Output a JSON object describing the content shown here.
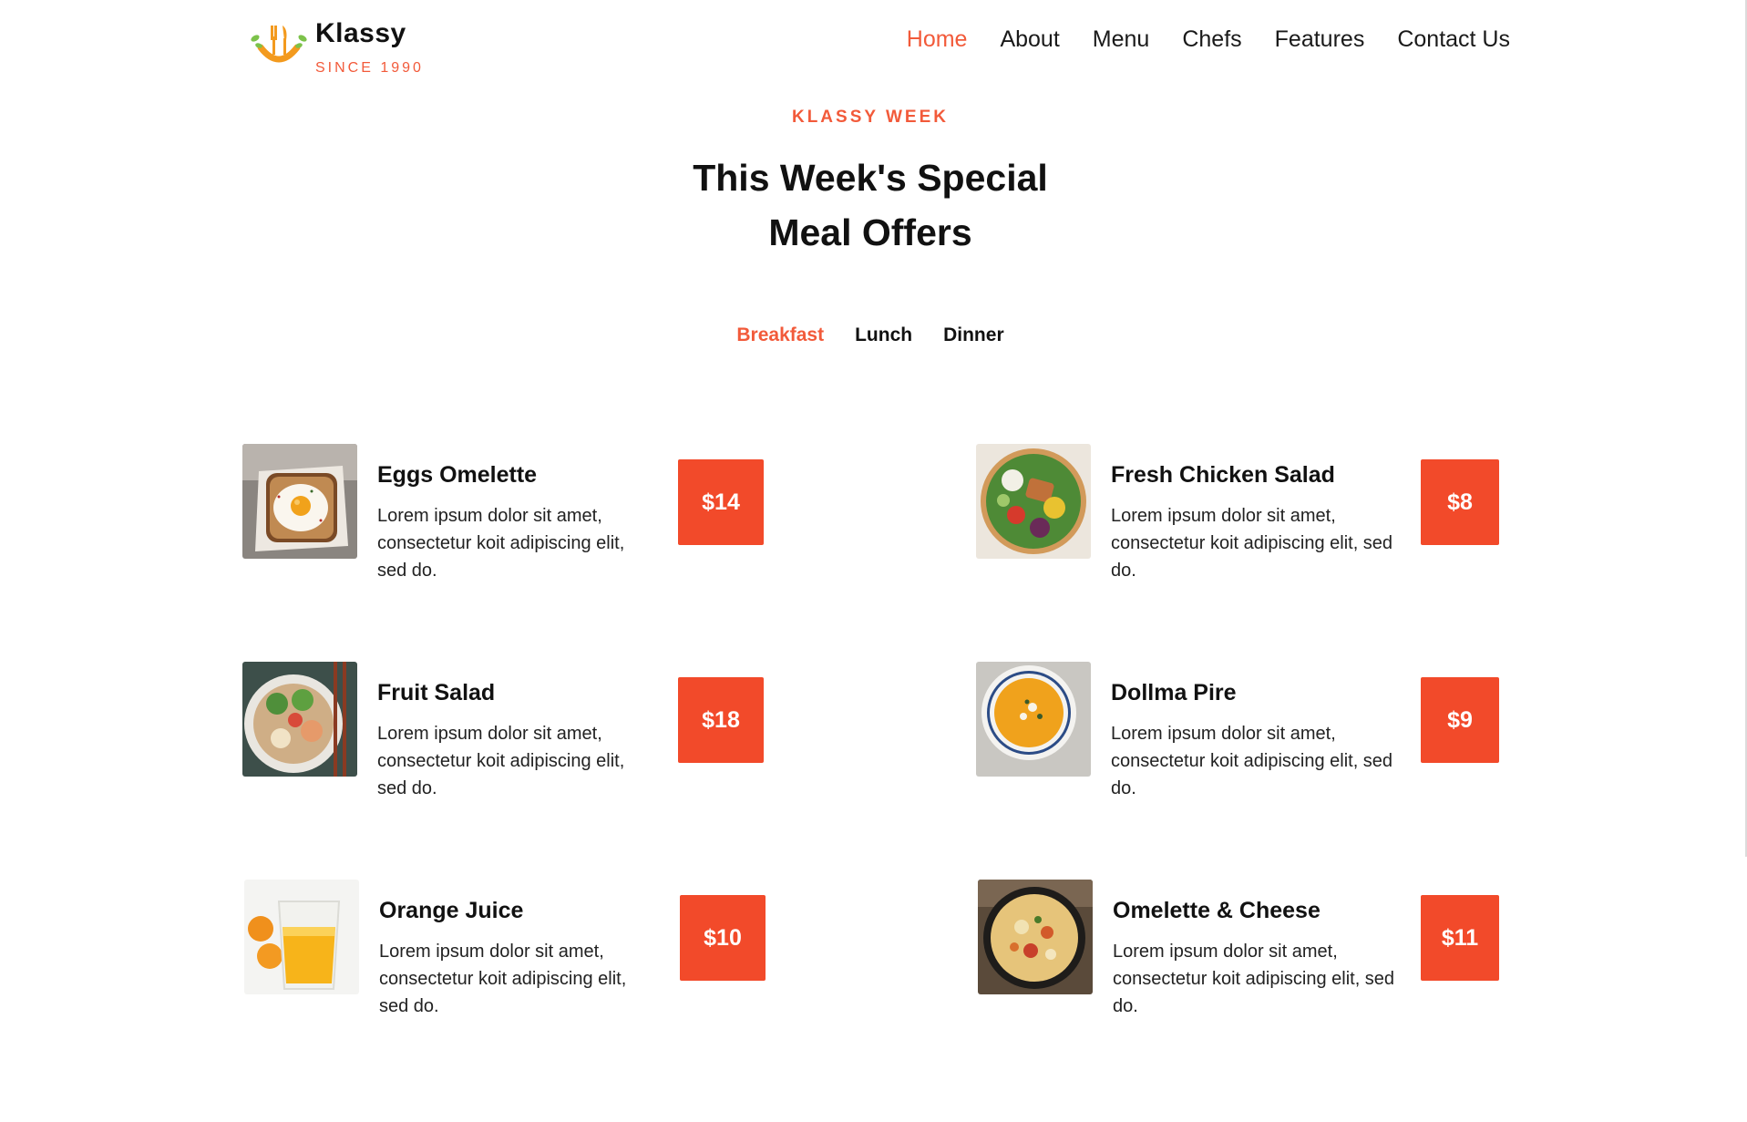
{
  "brand": {
    "name": "Klassy",
    "tagline": "SINCE 1990",
    "accent_color": "#f25a3a",
    "logo_icon": "fork-knife-smile-logo"
  },
  "nav": {
    "items": [
      "Home",
      "About",
      "Menu",
      "Chefs",
      "Features",
      "Contact Us"
    ],
    "active": "Home"
  },
  "section": {
    "eyebrow": "KLASSY WEEK",
    "title_line1": "This Week's Special",
    "title_line2": "Meal Offers"
  },
  "tabs": {
    "items": [
      "Breakfast",
      "Lunch",
      "Dinner"
    ],
    "active": "Breakfast"
  },
  "menu": [
    {
      "name": "Eggs Omelette",
      "desc": "Lorem ipsum dolor sit amet, consectetur koit adipiscing elit, sed do.",
      "price": "$14",
      "image": "fried-egg-toast-photo"
    },
    {
      "name": "Fresh Chicken Salad",
      "desc": "Lorem ipsum dolor sit amet, consectetur koit adipiscing elit, sed do.",
      "price": "$8",
      "image": "chicken-salad-bowl-photo"
    },
    {
      "name": "Fruit Salad",
      "desc": "Lorem ipsum dolor sit amet, consectetur koit adipiscing elit, sed do.",
      "price": "$18",
      "image": "fruit-salad-bowl-photo"
    },
    {
      "name": "Dollma Pire",
      "desc": "Lorem ipsum dolor sit amet, consectetur koit adipiscing elit, sed do.",
      "price": "$9",
      "image": "pumpkin-soup-photo"
    },
    {
      "name": "Orange Juice",
      "desc": "Lorem ipsum dolor sit amet, consectetur koit adipiscing elit, sed do.",
      "price": "$10",
      "image": "orange-juice-glass-photo"
    },
    {
      "name": "Omelette & Cheese",
      "desc": "Lorem ipsum dolor sit amet, consectetur koit adipiscing elit, sed do.",
      "price": "$11",
      "image": "cheese-omelette-pan-photo"
    }
  ]
}
